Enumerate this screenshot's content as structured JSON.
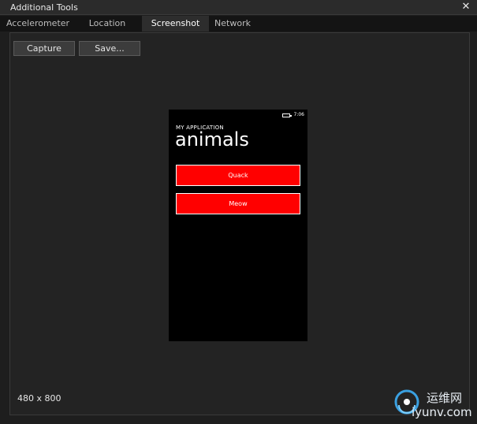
{
  "window": {
    "title": "Additional Tools",
    "close_glyph": "✕"
  },
  "tabs": [
    {
      "label": "Accelerometer",
      "active": false
    },
    {
      "label": "Location",
      "active": false
    },
    {
      "label": "Screenshot",
      "active": true
    },
    {
      "label": "Network",
      "active": false
    }
  ],
  "toolbar": {
    "capture_label": "Capture",
    "save_label": "Save..."
  },
  "phone": {
    "status_time": "7:06",
    "app_title": "MY APPLICATION",
    "page_title": "animals",
    "buttons": [
      {
        "label": "Quack"
      },
      {
        "label": "Meow"
      }
    ]
  },
  "resolution": "480 x 800",
  "watermark": {
    "line1": "运维网",
    "line2": "iyunv.com"
  },
  "colors": {
    "accent_button": "#ff0000",
    "background": "#1e1e1e"
  }
}
